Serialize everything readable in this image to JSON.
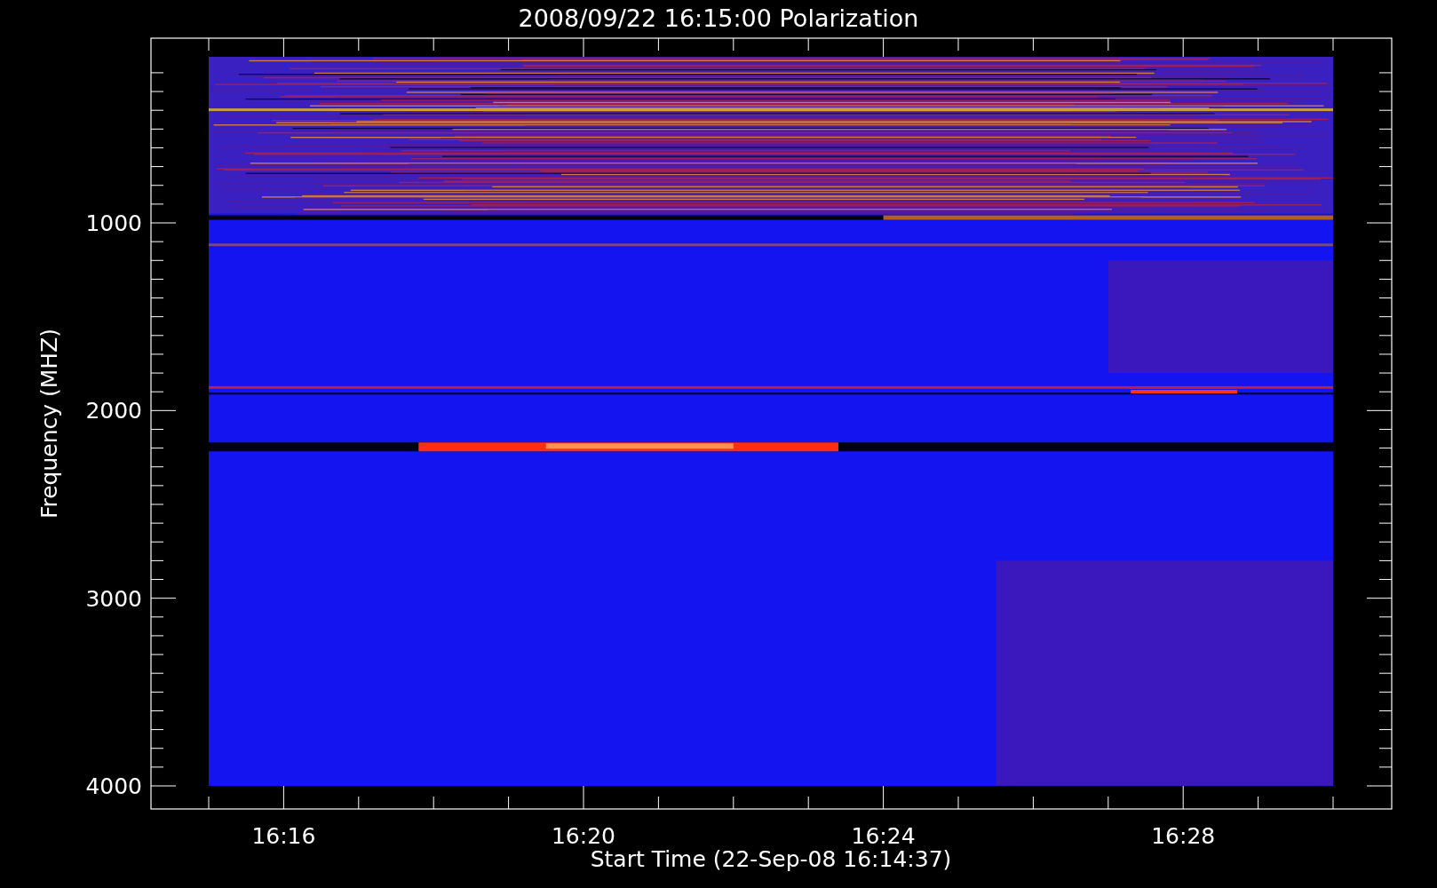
{
  "plot": {
    "title": "2008/09/22 16:15:00 Polarization",
    "ylabel": "Frequency (MHZ)",
    "xlabel": "Start Time (22-Sep-08 16:14:37)",
    "yticks": [
      "1000",
      "2000",
      "3000",
      "4000"
    ],
    "xticks": [
      "16:16",
      "16:20",
      "16:24",
      "16:28"
    ]
  }
}
